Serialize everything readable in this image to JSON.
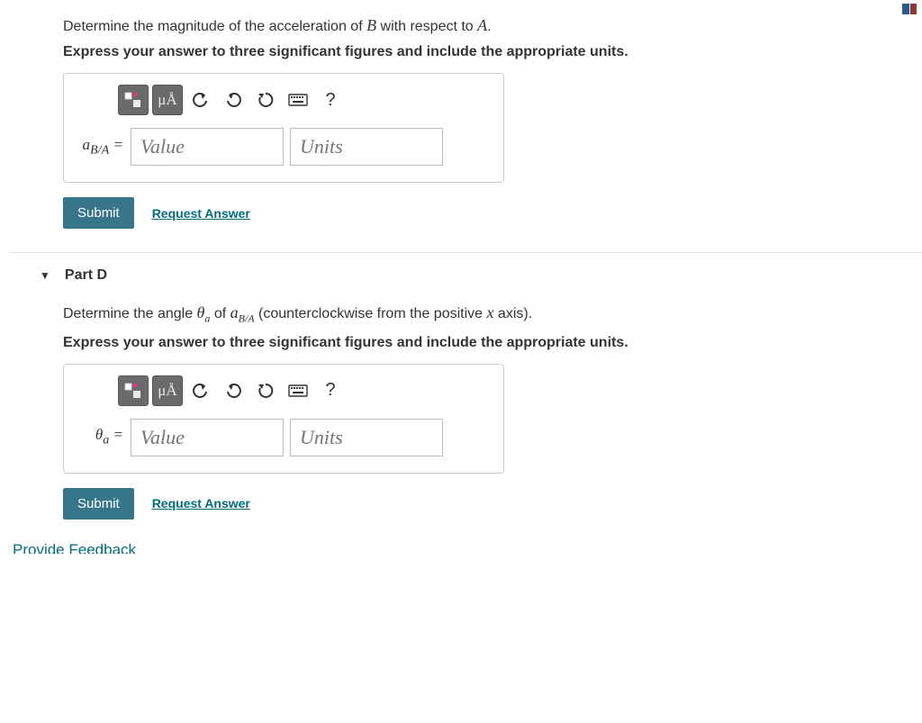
{
  "partC": {
    "prompt_pre": "Determine the magnitude of the acceleration of ",
    "prompt_mid": " with respect to ",
    "prompt_B": "B",
    "prompt_A": "A",
    "prompt_post": ".",
    "instruction": "Express your answer to three significant figures and include the appropriate units.",
    "label_html": "a",
    "label_sub": "B/A",
    "value_placeholder": "Value",
    "units_placeholder": "Units",
    "submit": "Submit",
    "request": "Request Answer"
  },
  "partD": {
    "header": "Part D",
    "prompt_pre": "Determine the angle ",
    "theta": "θ",
    "theta_sub": "a",
    "prompt_mid1": " of ",
    "a": "a",
    "a_sub": "B/A",
    "prompt_mid2": " (counterclockwise from the positive ",
    "x": "x",
    "prompt_post": " axis).",
    "instruction": "Express your answer to three significant figures and include the appropriate units.",
    "label_html": "θ",
    "label_sub": "a",
    "value_placeholder": "Value",
    "units_placeholder": "Units",
    "submit": "Submit",
    "request": "Request Answer"
  },
  "toolbar": {
    "ua": "μÅ",
    "help": "?"
  },
  "feedback": "Provide Feedback"
}
